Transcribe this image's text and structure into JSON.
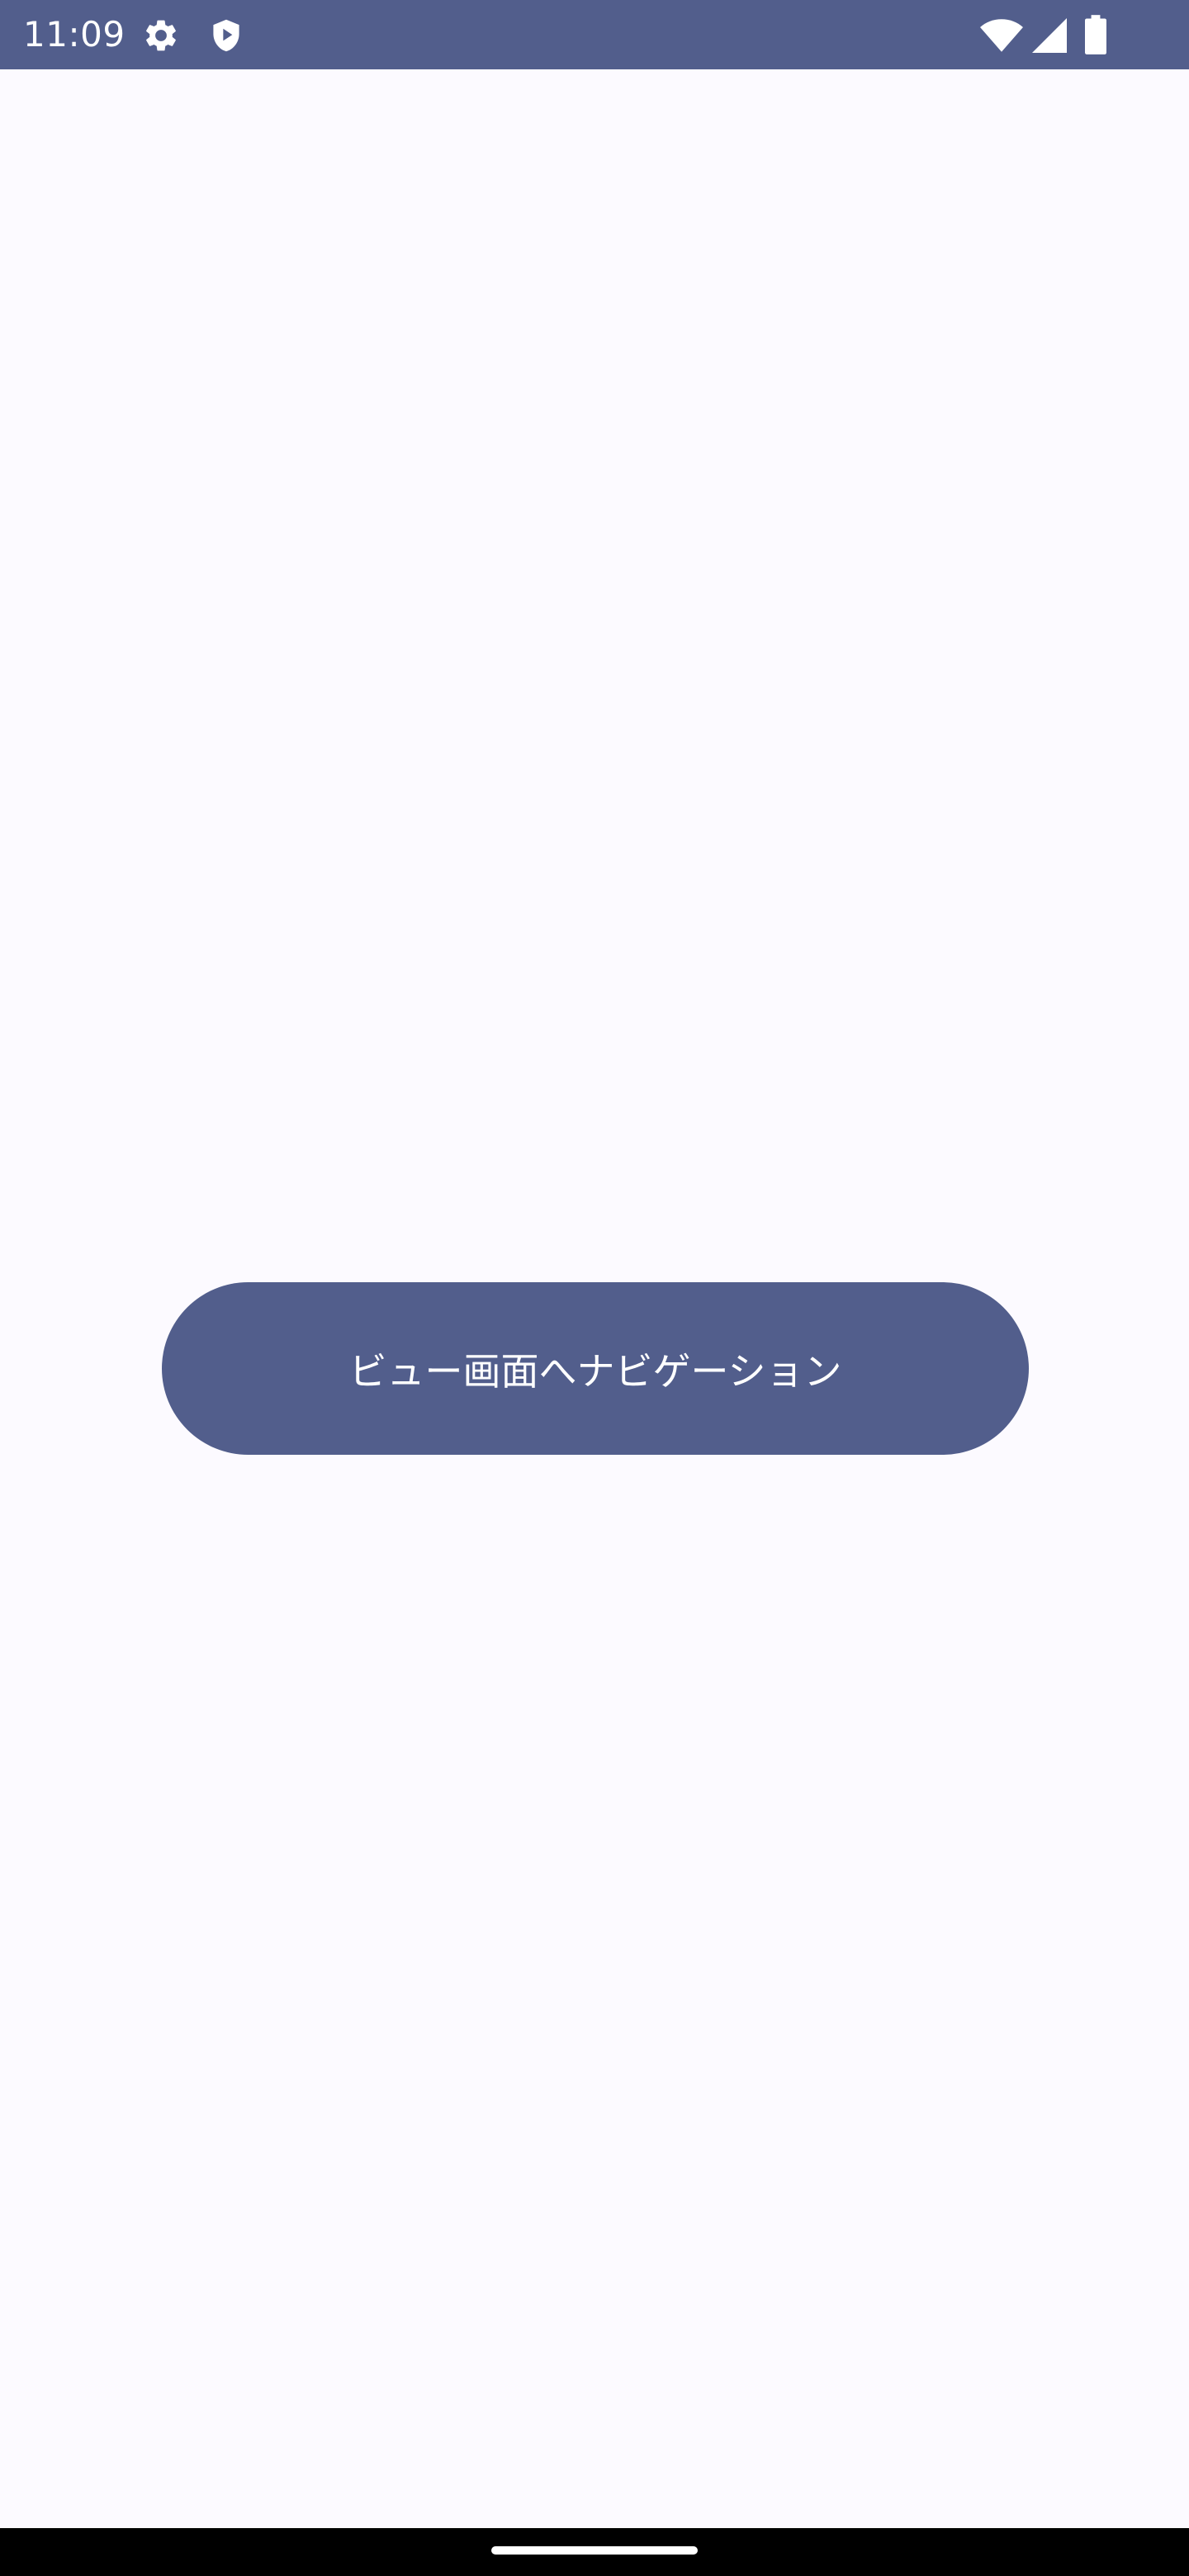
{
  "status_bar": {
    "time": "11:09",
    "icons": [
      "gear-icon",
      "shield-icon",
      "wifi-icon",
      "signal-icon",
      "battery-icon"
    ],
    "background_color": "#525e8c"
  },
  "main": {
    "navigate_button_label": "ビュー画面へナビゲーション",
    "button_color": "#525e8c",
    "background_color": "#fcfaff"
  },
  "nav_bar": {
    "home_indicator_icon": "home-indicator"
  }
}
